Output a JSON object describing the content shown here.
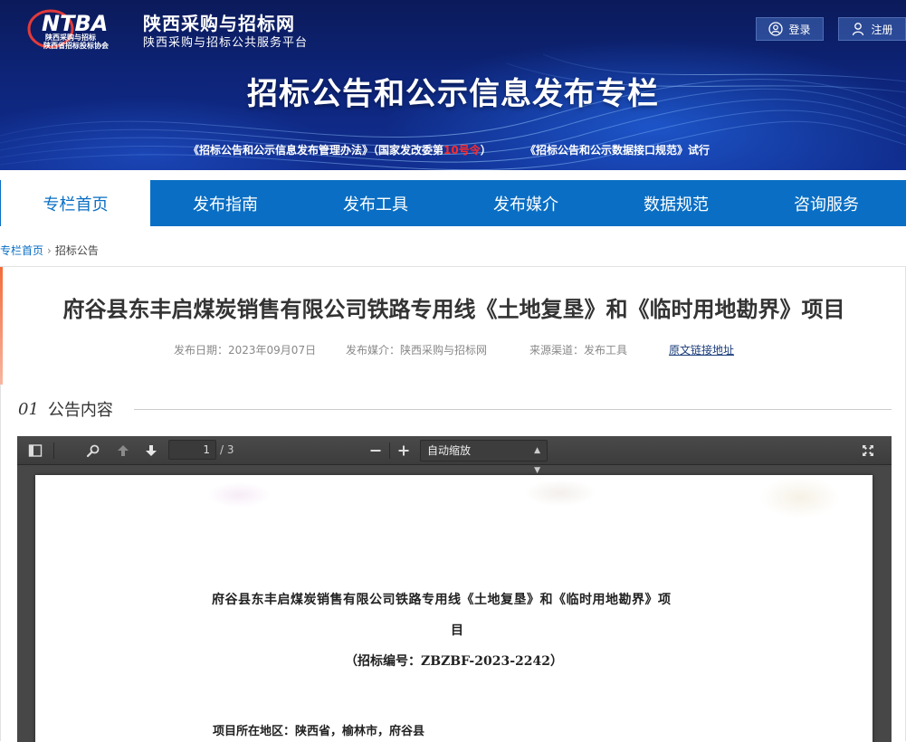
{
  "header": {
    "logo_text": "NTBA",
    "logo_sub_line1": "陕西采购与招标",
    "logo_sub_line2": "陕西省招标投标协会",
    "site_title": "陕西采购与招标网",
    "site_subtitle": "陕西采购与招标公共服务平台",
    "login_label": "登录",
    "register_label": "注册",
    "banner_title": "招标公告和公示信息发布专栏",
    "link1_prefix": "《招标公告和公示信息发布管理办法》（国家发改委第",
    "link1_red": "10号令",
    "link1_suffix": "）",
    "link2": "《招标公告和公示数据接口规范》试行"
  },
  "nav": {
    "items": [
      {
        "label": "专栏首页"
      },
      {
        "label": "发布指南"
      },
      {
        "label": "发布工具"
      },
      {
        "label": "发布媒介"
      },
      {
        "label": "数据规范"
      },
      {
        "label": "咨询服务"
      }
    ]
  },
  "breadcrumb": {
    "home": "专栏首页",
    "current": "招标公告"
  },
  "article": {
    "title": "府谷县东丰启煤炭销售有限公司铁路专用线《土地复垦》和《临时用地勘界》项目",
    "publish_date": "发布日期：2023年09月07日",
    "publish_media": "发布媒介：陕西采购与招标网",
    "source_channel": "来源渠道：发布工具",
    "original_link": "原文链接地址",
    "section_num": "01",
    "section_label": "公告内容"
  },
  "viewer": {
    "page_current": "1",
    "page_total": "/ 3",
    "zoom": "自动缩放",
    "pdf_line1": "府谷县东丰启煤炭销售有限公司铁路专用线《土地复垦》和《临时用地勘界》项",
    "pdf_line2": "目",
    "pdf_line3": "（招标编号：ZBZBF-2023-2242）",
    "pdf_line4": "项目所在地区：陕西省，榆林市，府谷县"
  },
  "colors": {
    "nav_blue": "#0a6fc4",
    "banner_navy": "#0d2478",
    "accent_red": "#ff2a2a",
    "link_navy": "#1a3c7a"
  }
}
